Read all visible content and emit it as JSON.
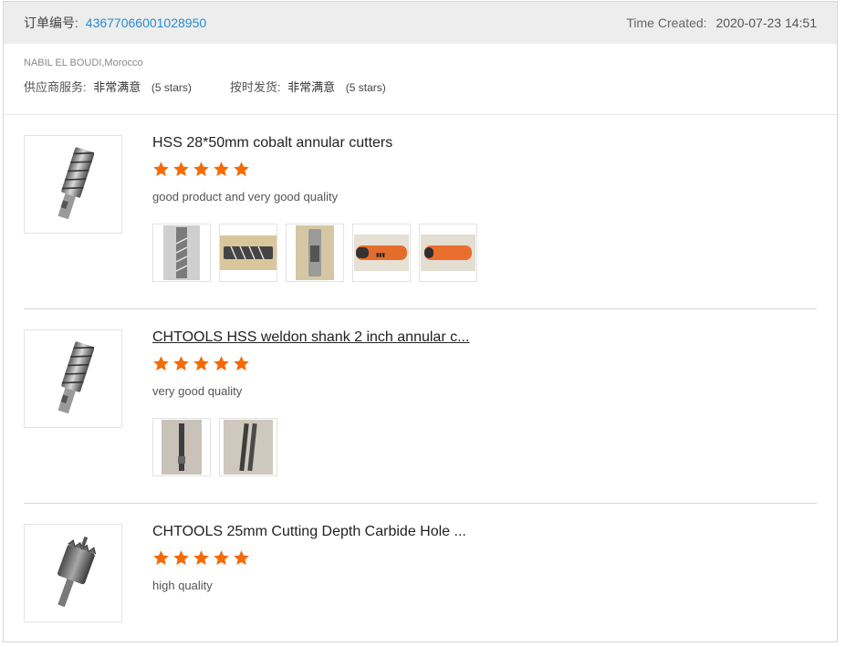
{
  "order": {
    "label": "订单编号:",
    "id": "43677066001028950",
    "time_label": "Time Created:",
    "time_value": "2020-07-23 14:51"
  },
  "buyer": {
    "name": "NABIL EL BOUDI,Morocco",
    "ratings": [
      {
        "label": "供应商服务:",
        "value": "非常满意",
        "stars": "(5 stars)"
      },
      {
        "label": "按时发货:",
        "value": "非常满意",
        "stars": "(5 stars)"
      }
    ]
  },
  "reviews": [
    {
      "title": "HSS 28*50mm cobalt annular cutters",
      "rating": 5,
      "comment": "good product and very good quality",
      "thumb_icon": "annular-cutter-icon",
      "photo_count": 5
    },
    {
      "title": "CHTOOLS HSS weldon shank 2 inch annular c...",
      "rating": 5,
      "comment": "very good quality",
      "thumb_icon": "annular-cutter-icon",
      "photo_count": 2
    },
    {
      "title": "CHTOOLS 25mm Cutting Depth Carbide Hole ...",
      "rating": 5,
      "comment": "high quality",
      "thumb_icon": "hole-saw-icon",
      "photo_count": 0
    }
  ],
  "colors": {
    "accent_link": "#2a8ccf",
    "star": "#f46a06",
    "header_bg": "#ededed"
  }
}
